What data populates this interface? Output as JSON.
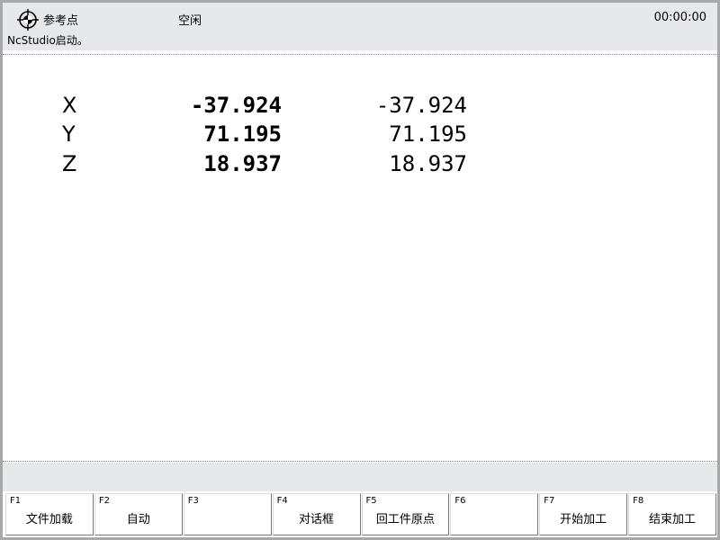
{
  "status": {
    "reference_label": "参考点",
    "state": "空闲",
    "timer": "00:00:00",
    "message": "NcStudio启动。"
  },
  "coordinates": [
    {
      "axis": "X",
      "machine": "-37.924",
      "work": "-37.924"
    },
    {
      "axis": "Y",
      "machine": "71.195",
      "work": "71.195"
    },
    {
      "axis": "Z",
      "machine": "18.937",
      "work": "18.937"
    }
  ],
  "function_keys": [
    {
      "key": "F1",
      "label": "文件加载"
    },
    {
      "key": "F2",
      "label": "自动"
    },
    {
      "key": "F3",
      "label": ""
    },
    {
      "key": "F4",
      "label": "对话框"
    },
    {
      "key": "F5",
      "label": "回工件原点"
    },
    {
      "key": "F6",
      "label": ""
    },
    {
      "key": "F7",
      "label": "开始加工"
    },
    {
      "key": "F8",
      "label": "结束加工"
    }
  ]
}
